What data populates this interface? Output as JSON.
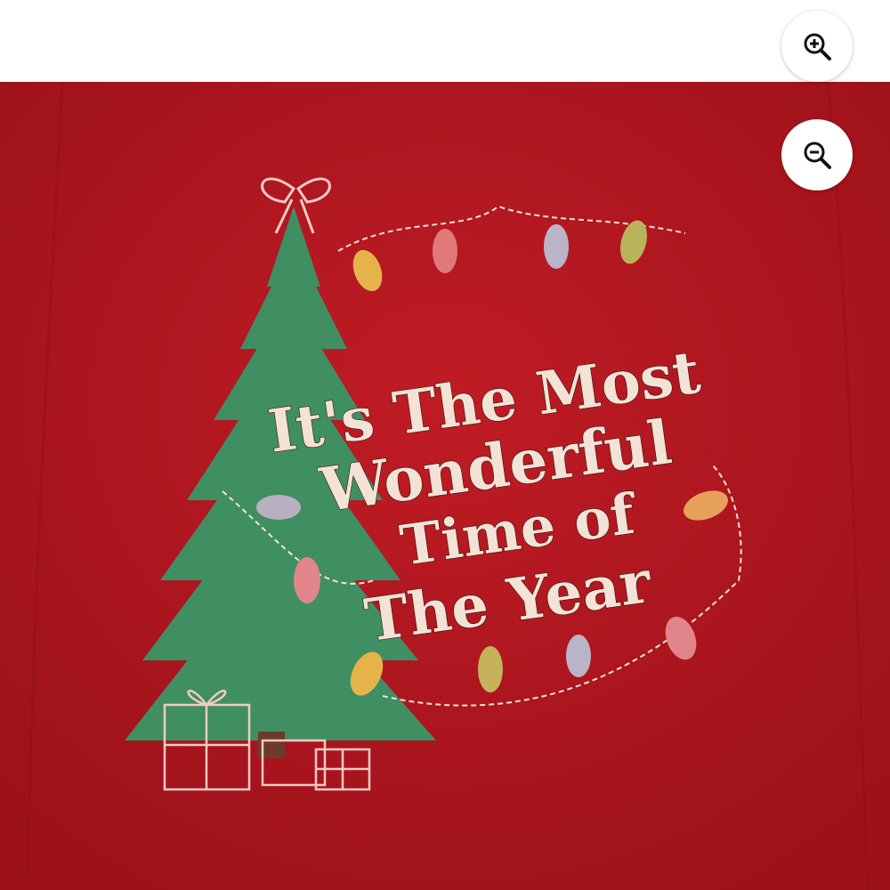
{
  "viewer": {
    "zoom_in_icon": "magnifier-plus-icon",
    "zoom_out_icon": "magnifier-minus-icon"
  },
  "product_print": {
    "line1": "It's The Most",
    "line2": "Wonderful",
    "line3": "Time of",
    "line4": "The Year"
  },
  "colors": {
    "background": "#ffffff",
    "sweater": "#b3161f",
    "print_text": "#f3e2d6",
    "tree": "#3f8f63"
  }
}
